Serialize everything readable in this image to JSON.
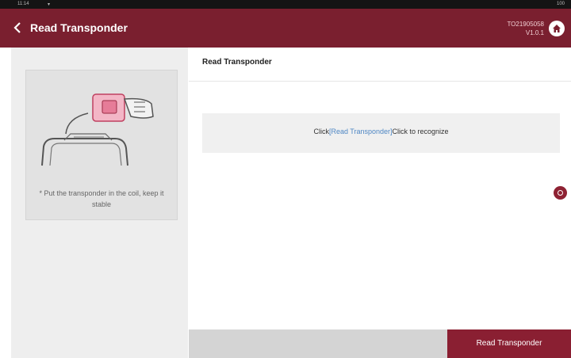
{
  "status_bar": {
    "time": "11:14",
    "wifi": "▾",
    "battery": "100"
  },
  "header": {
    "back_icon": "chevron-left-icon",
    "title": "Read Transponder",
    "serial": "TO21905058",
    "version": "V1.0.1",
    "home_icon": "home-icon"
  },
  "sidebar": {
    "hint_text": "* Put the transponder in the coil, keep it stable"
  },
  "main": {
    "header_title": "Read Transponder",
    "info_prefix": "Click",
    "info_link": "[Read Transponder]",
    "info_suffix": "Click to recognize"
  },
  "footer": {
    "read_button": "Read Transponder"
  },
  "colors": {
    "header_bg": "#7a1f2f",
    "accent": "#8a1f32",
    "link": "#4f87c4"
  }
}
